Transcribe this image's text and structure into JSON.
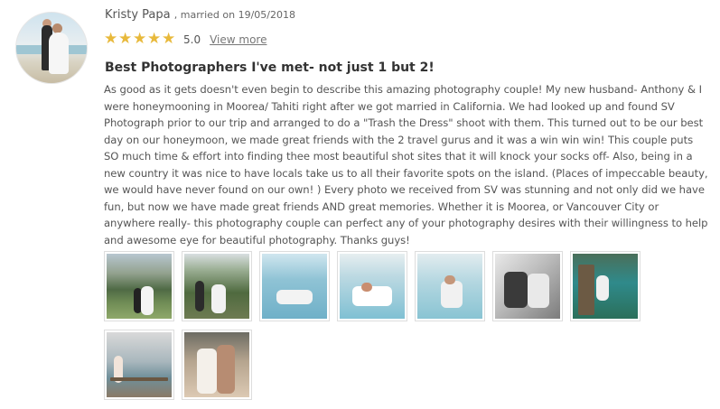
{
  "review": {
    "reviewer_name": "Kristy Papa",
    "married_text": ", married on 19/05/2018",
    "rating_score": "5.0",
    "rating_stars": 5,
    "view_more_label": "View more",
    "title": "Best Photographers I've met- not just 1 but 2!",
    "body": "As good as it gets doesn't even begin to describe this amazing photography couple! My new husband- Anthony & I were honeymooning in Moorea/ Tahiti right after we got married in California. We had looked up and found SV Photograph prior to our trip and arranged to do a \"Trash the Dress\" shoot with them. This turned out to be our best day on our honeymoon, we made great friends with the 2 travel gurus and it was a win win win! This couple puts SO much time & effort into finding thee most beautiful shot sites that it will knock your socks off- Also, being in a new country it was nice to have locals take us to all their favorite spots on the island. (Places of impeccable beauty, we would have never found on our own! ) Every photo we received from SV was stunning and not only did we have fun, but now we have made great friends AND great memories. Whether it is Moorea, or Vancouver City or anywhere really- this photography couple can perfect any of your photography desires with their willingness to help and awesome eye for beautiful photography. Thanks guys!"
  },
  "colors": {
    "star": "#e8b93b",
    "title": "#333333",
    "body_text": "#555555"
  },
  "gallery": {
    "photo_count": 9
  }
}
